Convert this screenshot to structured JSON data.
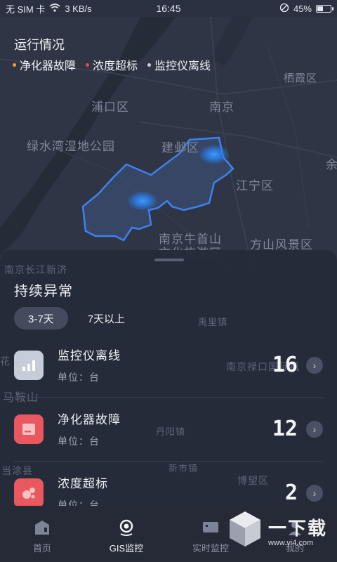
{
  "status_bar": {
    "carrier": "无 SIM 卡",
    "speed": "3 KB/s",
    "time": "16:45",
    "battery": "45%",
    "battery_level": 0.45
  },
  "map": {
    "title": "运行情况",
    "legend": [
      {
        "label": "净化器故障",
        "color": "#f0a22b"
      },
      {
        "label": "浓度超标",
        "color": "#e5484d"
      },
      {
        "label": "监控仪离线",
        "color": "#c9ced8"
      }
    ],
    "places": [
      "栖霞区",
      "浦口区",
      "南京",
      "绿水湾湿地公园",
      "建邺区",
      "江宁区",
      "南京牛首山",
      "文化旅游区",
      "方山风景区",
      "余",
      "南京长江新济",
      "马鞍山",
      "禹里镇",
      "南京禄口国际机",
      "丹阳镇",
      "新市镇",
      "博望区",
      "当涂县",
      "花"
    ]
  },
  "sheet": {
    "title": "持续异常",
    "tabs": [
      {
        "label": "3-7天",
        "active": true
      },
      {
        "label": "7天以上",
        "active": false
      }
    ],
    "rows": [
      {
        "name": "监控仪离线",
        "unit": "单位：台",
        "count": "16",
        "icon": "signal-bars-icon"
      },
      {
        "name": "净化器故障",
        "unit": "单位：台",
        "count": "12",
        "icon": "device-panel-icon"
      },
      {
        "name": "浓度超标",
        "unit": "单位：台",
        "count": "2",
        "icon": "bubbles-icon"
      }
    ]
  },
  "tabbar": {
    "items": [
      {
        "label": "首页",
        "icon": "home-icon",
        "active": false
      },
      {
        "label": "GIS监控",
        "icon": "map-pin-icon",
        "active": true
      },
      {
        "label": "实时监控",
        "icon": "monitor-icon",
        "active": false
      },
      {
        "label": "我的",
        "icon": "profile-icon",
        "active": false
      }
    ]
  },
  "watermark": {
    "brand": "一下载",
    "url": "www.yi4.com"
  }
}
